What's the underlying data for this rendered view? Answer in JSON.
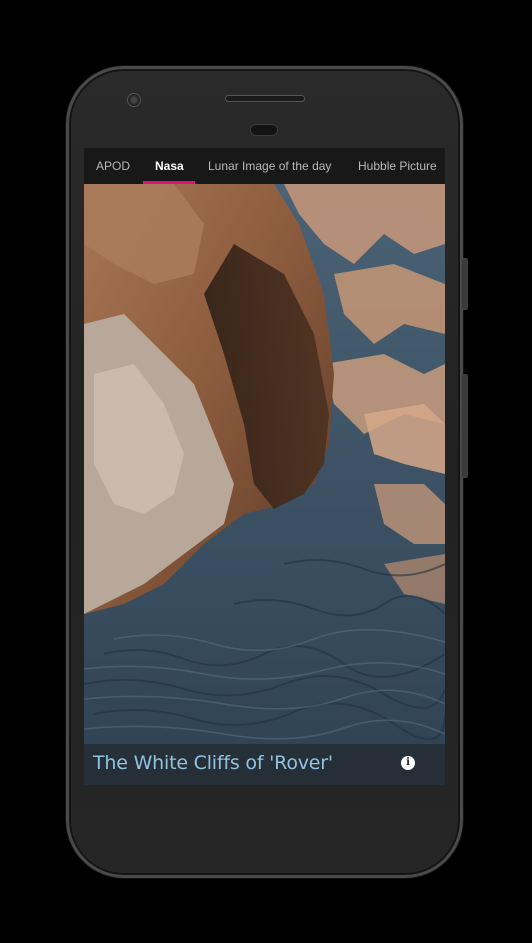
{
  "tabs": [
    {
      "label": "APOD",
      "active": false
    },
    {
      "label": "Nasa",
      "active": true
    },
    {
      "label": "Lunar Image of the day",
      "active": false
    },
    {
      "label": "Hubble Picture",
      "active": false
    }
  ],
  "active_tab_color": "#e0117a",
  "image": {
    "caption": "The White Cliffs of 'Rover'",
    "info_icon": "info-icon"
  }
}
